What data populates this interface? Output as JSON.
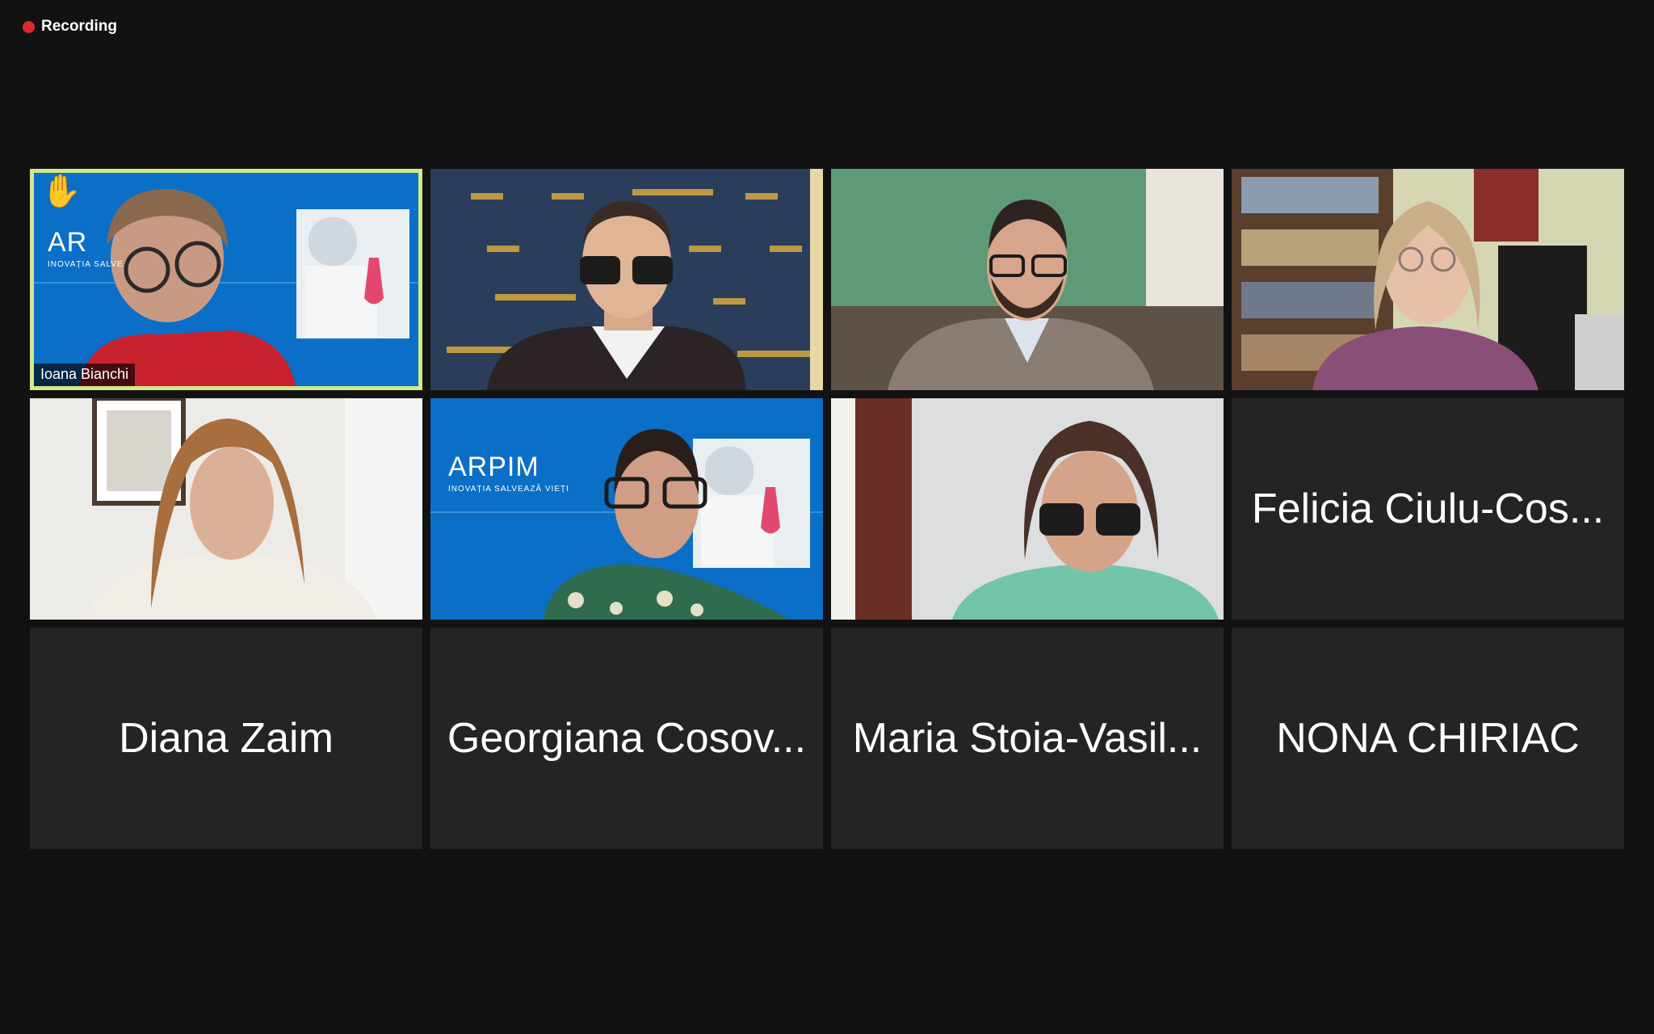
{
  "recording": {
    "label": "Recording",
    "color": "#e0282e"
  },
  "active_speaker_border_color": "#d4e88a",
  "participants": [
    {
      "name": "Ioana Bianchi",
      "video": true,
      "raised_hand": true,
      "active": true
    },
    {
      "name": "",
      "video": true
    },
    {
      "name": "",
      "video": true
    },
    {
      "name": "",
      "video": true
    },
    {
      "name": "",
      "video": true
    },
    {
      "name": "",
      "video": true
    },
    {
      "name": "",
      "video": true
    },
    {
      "name": "Felicia Ciulu-Cos...",
      "video": false
    },
    {
      "name": "Diana Zaim",
      "video": false
    },
    {
      "name": "Georgiana Cosov...",
      "video": false
    },
    {
      "name": "Maria Stoia-Vasil...",
      "video": false
    },
    {
      "name": "NONA CHIRIAC",
      "video": false
    }
  ],
  "backgrounds": {
    "arpim_brand": "ARPIM",
    "arpim_tagline": "INOVAȚIA SALVEAZĂ VIEȚI",
    "partial_brand": "AR",
    "partial_tagline": "INOVAȚIA SALVE"
  }
}
